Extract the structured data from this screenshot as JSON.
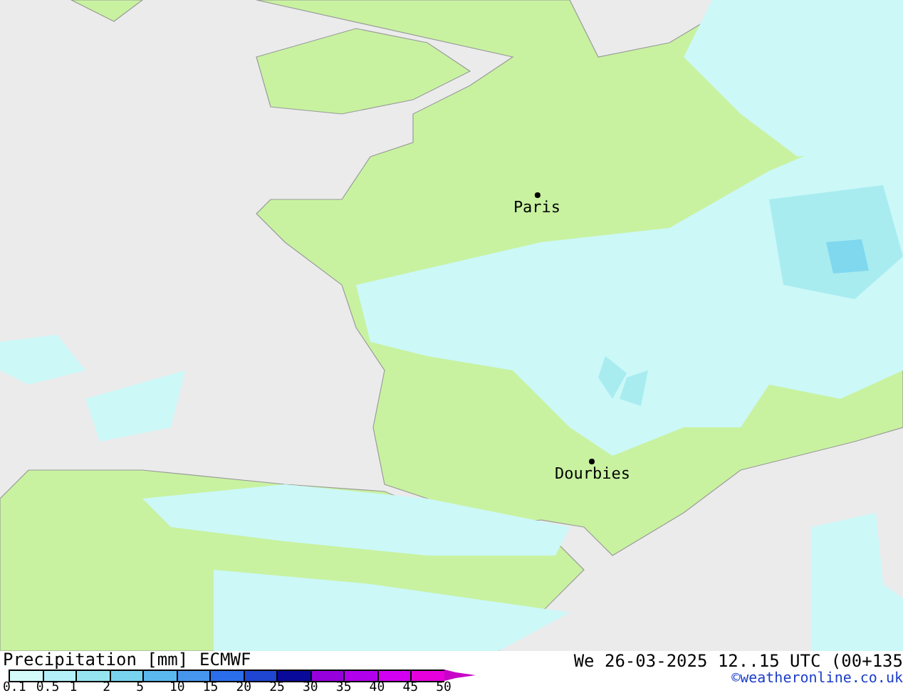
{
  "map": {
    "places": [
      {
        "name": "Paris"
      },
      {
        "name": "Dourbies"
      }
    ]
  },
  "legend": {
    "title": "Precipitation [mm]",
    "model": "ECMWF",
    "bins": [
      {
        "color": "#d4fafa"
      },
      {
        "color": "#b4f0f8"
      },
      {
        "color": "#96e4f0"
      },
      {
        "color": "#78d4ee"
      },
      {
        "color": "#5ab8ee"
      },
      {
        "color": "#4696ee"
      },
      {
        "color": "#2a6eec"
      },
      {
        "color": "#1e46d2"
      },
      {
        "color": "#0a0a9a"
      },
      {
        "color": "#9600dc"
      },
      {
        "color": "#b000ec"
      },
      {
        "color": "#d200f0"
      },
      {
        "color": "#e600dc"
      },
      {
        "color": "#c800c8"
      }
    ],
    "ticks": [
      "0.1",
      "0.5",
      "1",
      "2",
      "5",
      "10",
      "15",
      "20",
      "25",
      "30",
      "35",
      "40",
      "45",
      "50"
    ]
  },
  "valid_time": "We 26-03-2025 12..15 UTC (00+135",
  "credit": "©weatheronline.co.uk"
}
